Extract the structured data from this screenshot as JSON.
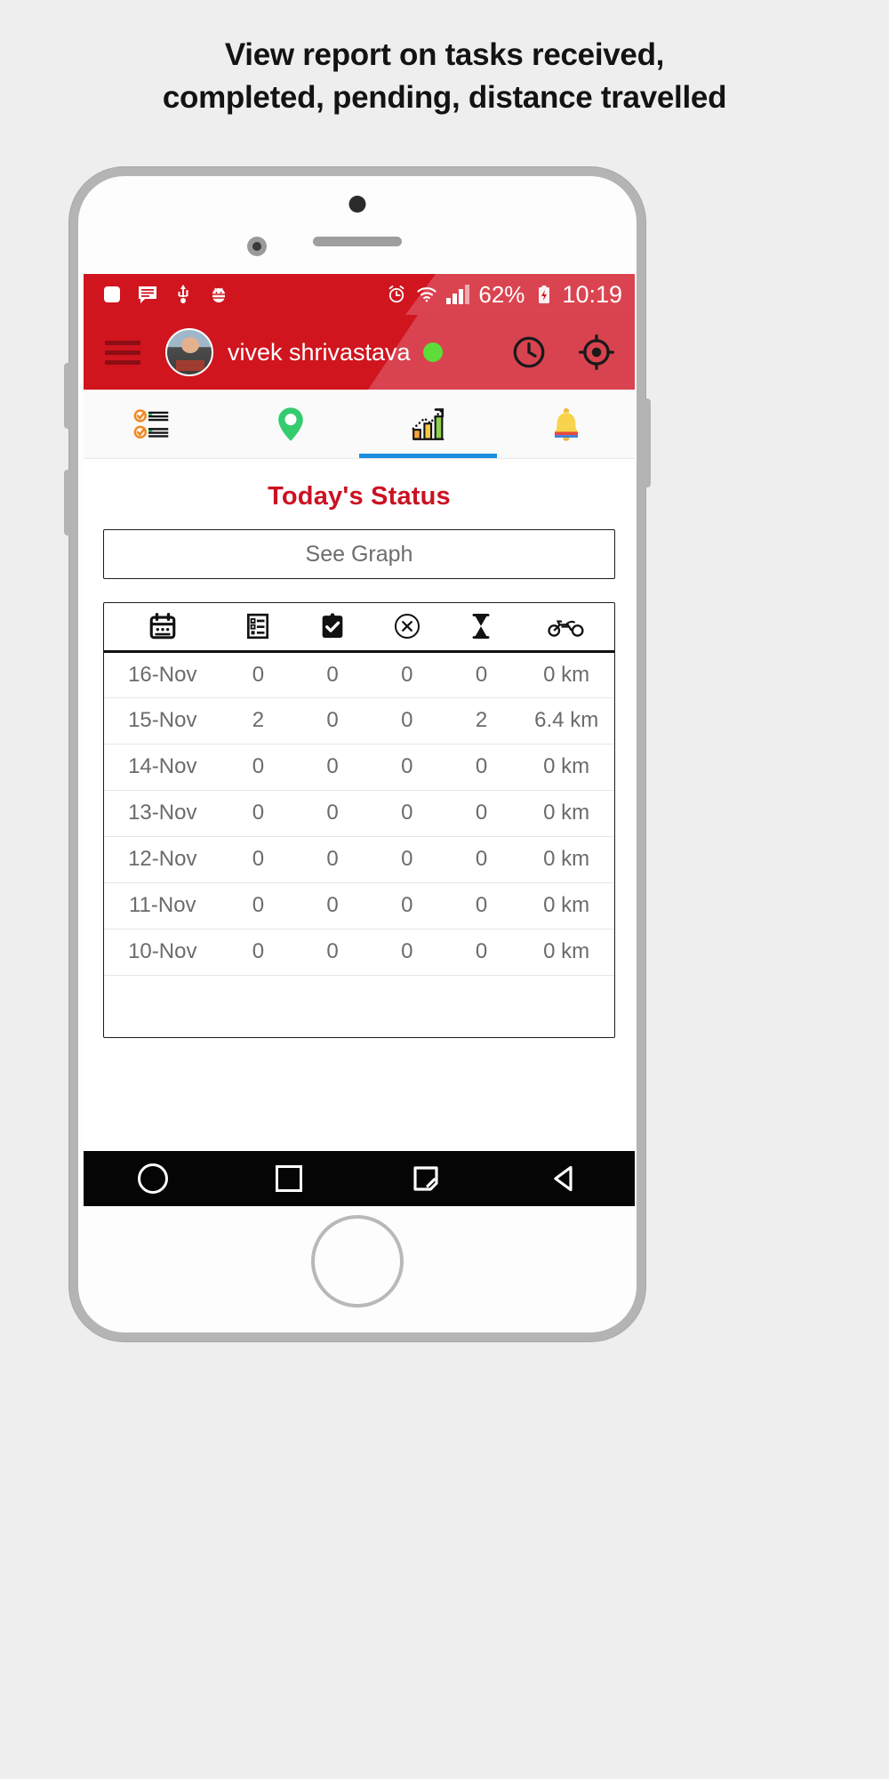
{
  "headline": {
    "line1": "View report on tasks received,",
    "line2": "completed, pending, distance travelled"
  },
  "phone": {
    "status_bar": {
      "left_icons": [
        "app-square-icon",
        "sms-message-icon",
        "usb-icon",
        "android-debug-bug-icon"
      ],
      "right_icons": [
        "alarm-clock-icon",
        "wifi-icon",
        "signal-bars-icon"
      ],
      "battery_percent": "62%",
      "battery_icon": "battery-charging-icon",
      "time": "10:19",
      "bg_color": "#d0151f"
    },
    "app_bar": {
      "menu_icon": "hamburger-menu-icon",
      "username": "vivek shrivastava",
      "status_dot_color": "#5ddc3a",
      "actions": [
        "history-clock-icon",
        "my-location-icon"
      ],
      "bg_color": "#d0151f"
    },
    "tabs": [
      {
        "name": "tasks-tab",
        "icon": "checklist-icon",
        "active": false
      },
      {
        "name": "map-tab",
        "icon": "location-pin-icon",
        "active": false
      },
      {
        "name": "report-tab",
        "icon": "bar-chart-growth-icon",
        "active": true
      },
      {
        "name": "notifications-tab",
        "icon": "bell-icon",
        "active": false
      }
    ],
    "active_tab_indicator_color": "#1e8fe0",
    "content": {
      "title": "Today's Status",
      "title_color": "#cc1122",
      "see_graph_label": "See Graph"
    },
    "navbar": {
      "buttons": [
        "home-circle-icon",
        "recents-square-icon",
        "screenshot-icon",
        "back-triangle-icon"
      ]
    }
  },
  "table": {
    "columns": [
      {
        "key": "date",
        "icon": "calendar-icon"
      },
      {
        "key": "received",
        "icon": "task-list-icon"
      },
      {
        "key": "completed",
        "icon": "clipboard-check-icon"
      },
      {
        "key": "cancelled",
        "icon": "x-circle-icon"
      },
      {
        "key": "pending",
        "icon": "hourglass-icon"
      },
      {
        "key": "distance",
        "icon": "motorcycle-icon"
      }
    ],
    "rows": [
      {
        "date": "16-Nov",
        "received": "0",
        "completed": "0",
        "cancelled": "0",
        "pending": "0",
        "distance": "0 km"
      },
      {
        "date": "15-Nov",
        "received": "2",
        "completed": "0",
        "cancelled": "0",
        "pending": "2",
        "distance": "6.4 km"
      },
      {
        "date": "14-Nov",
        "received": "0",
        "completed": "0",
        "cancelled": "0",
        "pending": "0",
        "distance": "0 km"
      },
      {
        "date": "13-Nov",
        "received": "0",
        "completed": "0",
        "cancelled": "0",
        "pending": "0",
        "distance": "0 km"
      },
      {
        "date": "12-Nov",
        "received": "0",
        "completed": "0",
        "cancelled": "0",
        "pending": "0",
        "distance": "0 km"
      },
      {
        "date": "11-Nov",
        "received": "0",
        "completed": "0",
        "cancelled": "0",
        "pending": "0",
        "distance": "0 km"
      },
      {
        "date": "10-Nov",
        "received": "0",
        "completed": "0",
        "cancelled": "0",
        "pending": "0",
        "distance": "0 km"
      }
    ]
  }
}
